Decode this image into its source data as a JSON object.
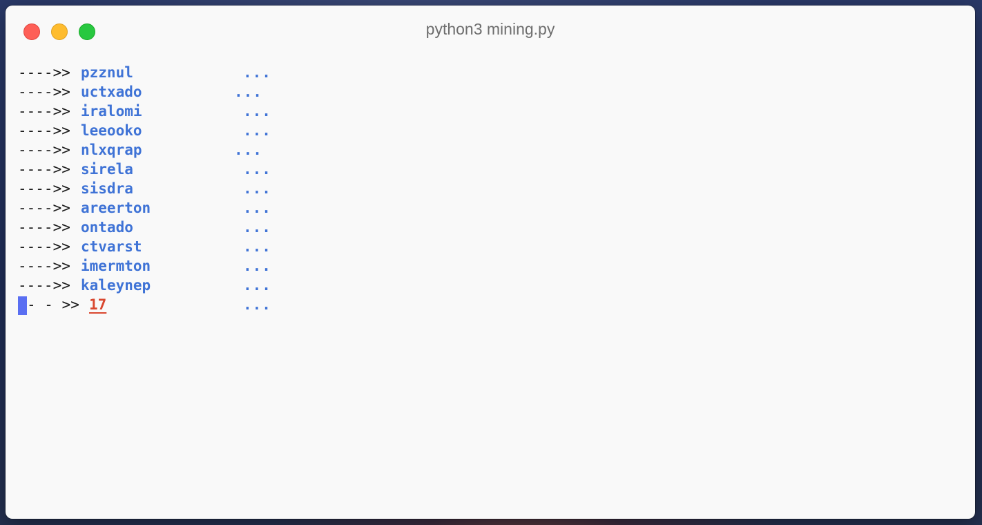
{
  "window": {
    "title": "python3 mining.py"
  },
  "colors": {
    "word": "#3f73d6",
    "typed": "#d9472f",
    "cursor": "#5a6ff2",
    "prompt": "#1b1b1b"
  },
  "terminal": {
    "prompt": "---->>",
    "lines": [
      {
        "word": "pzznul",
        "dots": "..."
      },
      {
        "word": "uctxado",
        "dots": "..."
      },
      {
        "word": "iralomi",
        "dots": "..."
      },
      {
        "word": "leeooko",
        "dots": "..."
      },
      {
        "word": "nlxqrap",
        "dots": "..."
      },
      {
        "word": "sirela",
        "dots": "..."
      },
      {
        "word": "sisdra",
        "dots": "..."
      },
      {
        "word": "areerton",
        "dots": "..."
      },
      {
        "word": "ontado",
        "dots": "..."
      },
      {
        "word": "ctvarst",
        "dots": "..."
      },
      {
        "word": "imermton",
        "dots": "..."
      },
      {
        "word": "kaleynep",
        "dots": "..."
      }
    ],
    "current": {
      "prompt": "- - >>",
      "typed": "17",
      "dots": "..."
    }
  }
}
